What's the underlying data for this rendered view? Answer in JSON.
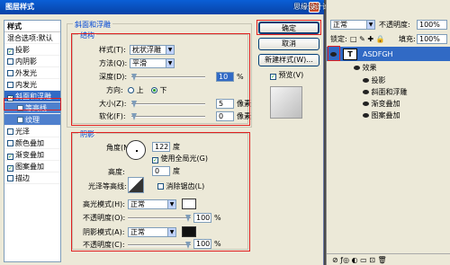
{
  "dialog": {
    "title": "图层样式",
    "close": "×"
  },
  "watermark": "思缘设计论坛 www.MISSYUAN.COM",
  "styles": {
    "header": "样式",
    "items": [
      {
        "label": "混合选项:默认",
        "checkbox": false,
        "checked": false
      },
      {
        "label": "投影",
        "checkbox": true,
        "checked": true
      },
      {
        "label": "内阴影",
        "checkbox": true,
        "checked": false
      },
      {
        "label": "外发光",
        "checkbox": true,
        "checked": false
      },
      {
        "label": "内发光",
        "checkbox": true,
        "checked": false
      },
      {
        "label": "斜面和浮雕",
        "checkbox": true,
        "checked": true,
        "selected": true
      },
      {
        "label": "等高线",
        "checkbox": true,
        "checked": false,
        "sub": true
      },
      {
        "label": "纹理",
        "checkbox": true,
        "checked": false,
        "sub": true
      },
      {
        "label": "光泽",
        "checkbox": true,
        "checked": false
      },
      {
        "label": "颜色叠加",
        "checkbox": true,
        "checked": false
      },
      {
        "label": "渐变叠加",
        "checkbox": true,
        "checked": true
      },
      {
        "label": "图案叠加",
        "checkbox": true,
        "checked": true
      },
      {
        "label": "描边",
        "checkbox": true,
        "checked": false
      }
    ]
  },
  "bevel": {
    "group_title": "斜面和浮雕",
    "structure_title": "结构",
    "style_label": "样式(T):",
    "style_value": "枕状浮雕",
    "method_label": "方法(Q):",
    "method_value": "平滑",
    "depth_label": "深度(D):",
    "depth_value": "10",
    "depth_unit": "%",
    "direction_label": "方向:",
    "dir_up": "上",
    "dir_down": "下",
    "size_label": "大小(Z):",
    "size_value": "5",
    "size_unit": "像素",
    "soften_label": "软化(F):",
    "soften_value": "0",
    "soften_unit": "像素"
  },
  "shading": {
    "title": "阴影",
    "angle_label": "角度(N):",
    "angle_value": "122",
    "angle_unit": "度",
    "global_light": "使用全局光(G)",
    "altitude_label": "高度:",
    "altitude_value": "0",
    "altitude_unit": "度",
    "gloss_label": "光泽等高线:",
    "antialias": "消除锯齿(L)",
    "highlight_label": "高光模式(H):",
    "highlight_mode": "正常",
    "h_opacity_label": "不透明度(O):",
    "h_opacity_value": "100",
    "h_opacity_unit": "%",
    "shadow_label": "阴影模式(A):",
    "shadow_mode": "正常",
    "s_opacity_label": "不透明度(C):",
    "s_opacity_value": "100",
    "s_opacity_unit": "%"
  },
  "buttons": {
    "ok": "确定",
    "cancel": "取消",
    "new_style": "新建样式(W)...",
    "preview": "预览(V)"
  },
  "layers": {
    "mode": "正常",
    "opacity_label": "不透明度:",
    "opacity_value": "100%",
    "lock_label": "锁定:",
    "fill_label": "填充:",
    "fill_value": "100%",
    "layer_name": "ASDFGH",
    "layer_t": "T",
    "effects_label": "效果",
    "effects": [
      "投影",
      "斜面和浮雕",
      "渐变叠加",
      "图案叠加"
    ]
  },
  "colors": {
    "accent": "#316ac5",
    "title": "#0842a6",
    "red": "#e02020"
  }
}
